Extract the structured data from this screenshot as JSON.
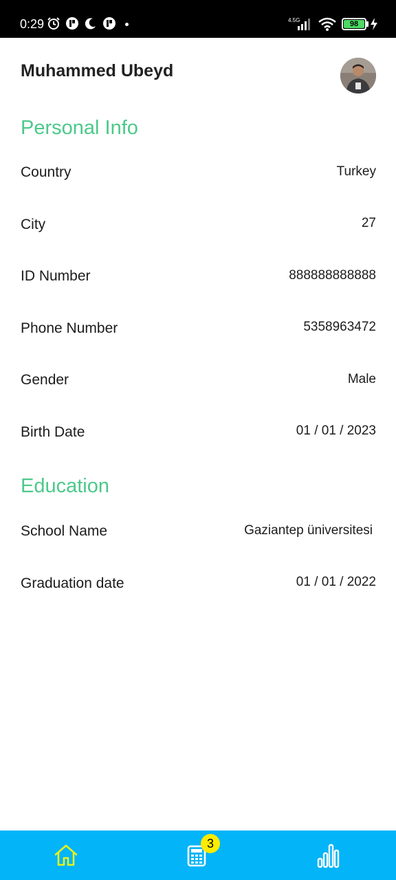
{
  "status_bar": {
    "time": "0:29",
    "network_type": "4.5G",
    "battery_level": "98"
  },
  "profile": {
    "name": "Muhammed Ubeyd"
  },
  "personal_info": {
    "title": "Personal Info",
    "rows": [
      {
        "label": "Country",
        "value": "Turkey"
      },
      {
        "label": "City",
        "value": "27"
      },
      {
        "label": "ID Number",
        "value": "888888888888"
      },
      {
        "label": "Phone Number",
        "value": "5358963472"
      },
      {
        "label": "Gender",
        "value": "Male"
      },
      {
        "label": "Birth Date",
        "value": "01 / 01 / 2023"
      }
    ]
  },
  "education": {
    "title": "Education",
    "rows": [
      {
        "label": "School Name",
        "value": "Gaziantep üniversitesi"
      },
      {
        "label": "Graduation date",
        "value": "01 / 01 / 2022"
      }
    ]
  },
  "bottom_nav": {
    "items": [
      {
        "icon": "home-icon"
      },
      {
        "icon": "calculator-icon",
        "badge": "3"
      },
      {
        "icon": "bar-chart-icon"
      }
    ]
  },
  "colors": {
    "accent_green": "#4cc98a",
    "nav_background": "#03b4f8",
    "nav_icon_yellow": "#e8f21a",
    "badge_yellow": "#ffeb00"
  }
}
